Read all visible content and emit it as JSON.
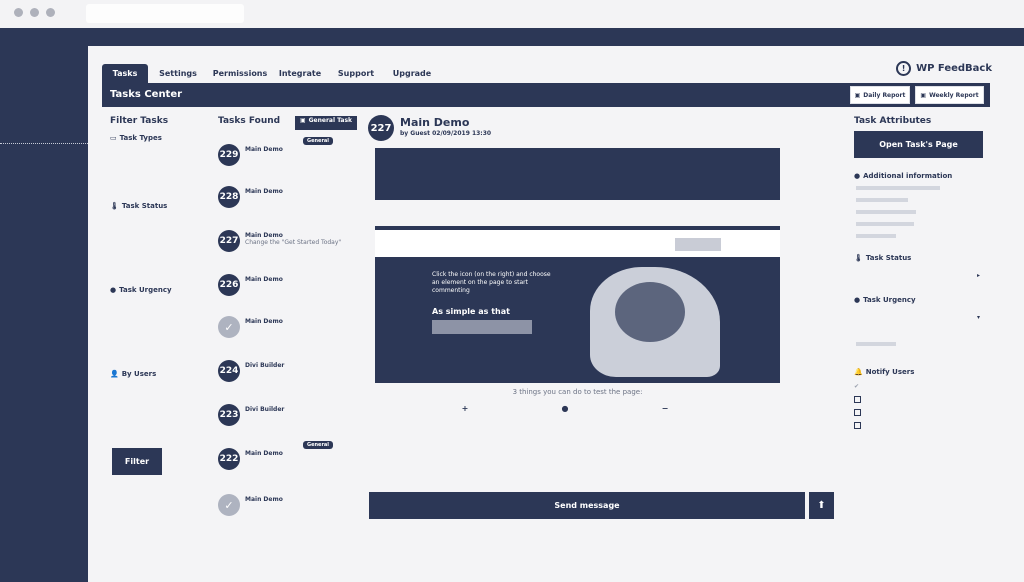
{
  "tabs": [
    "Tasks",
    "Settings",
    "Permissions",
    "Integrate",
    "Support",
    "Upgrade"
  ],
  "brand": {
    "name": "WP FeedBack",
    "icon": "feedback-logo-icon"
  },
  "header": {
    "title": "Tasks Center",
    "daily_report": "Daily Report",
    "weekly_report": "Weekly Report"
  },
  "filter": {
    "title": "Filter Tasks",
    "groups": [
      {
        "label": "Task Types",
        "icon": "monitor-icon"
      },
      {
        "label": "Task Status",
        "icon": "thermometer-icon"
      },
      {
        "label": "Task Urgency",
        "icon": "alert-circle-icon"
      },
      {
        "label": "By Users",
        "icon": "user-icon"
      }
    ],
    "button": "Filter"
  },
  "tasks": {
    "title": "Tasks Found",
    "general_button": "General Task",
    "items": [
      {
        "num": "229",
        "site": "Main Demo",
        "msg": "",
        "tag": "General",
        "done": false
      },
      {
        "num": "228",
        "site": "Main Demo",
        "msg": "",
        "tag": "",
        "done": false
      },
      {
        "num": "227",
        "site": "Main Demo",
        "msg": "Change the \"Get Started Today\"",
        "tag": "",
        "done": false
      },
      {
        "num": "226",
        "site": "Main Demo",
        "msg": "",
        "tag": "",
        "done": false
      },
      {
        "num": "",
        "site": "Main Demo",
        "msg": "",
        "tag": "",
        "done": true
      },
      {
        "num": "224",
        "site": "Divi Builder",
        "msg": "",
        "tag": "",
        "done": false
      },
      {
        "num": "223",
        "site": "Divi Builder",
        "msg": "",
        "tag": "",
        "done": false
      },
      {
        "num": "222",
        "site": "Main Demo",
        "msg": "",
        "tag": "General",
        "done": false
      },
      {
        "num": "",
        "site": "Main Demo",
        "msg": "",
        "tag": "",
        "done": true
      }
    ]
  },
  "main": {
    "num": "227",
    "title": "Main Demo",
    "by": "by Guest 02/09/2019 13:30",
    "hero_text": "Click the icon (on the right) and choose an element on the page to start commenting",
    "hero_title": "As simple as that",
    "things_title": "3 things you can do to test the page:",
    "send_button": "Send message"
  },
  "attributes": {
    "title": "Task Attributes",
    "open_button": "Open Task's Page",
    "additional_info": "Additional information",
    "task_status": "Task Status",
    "task_urgency": "Task Urgency",
    "notify_users": "Notify Users"
  },
  "colors": {
    "primary": "#2c3756",
    "panel": "#f4f4f6"
  }
}
